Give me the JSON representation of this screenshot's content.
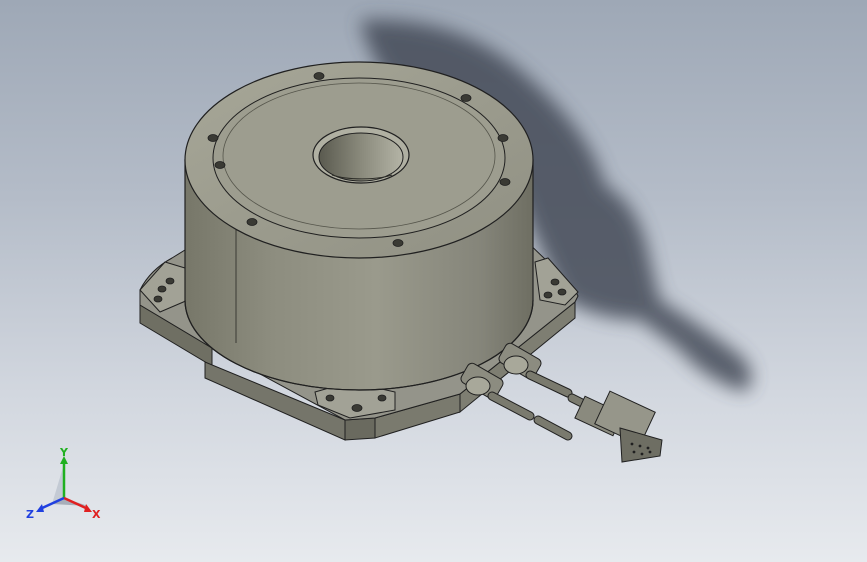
{
  "viewport": {
    "background_top": "#9ea8b6",
    "background_bottom": "#e7eaee"
  },
  "model": {
    "body_color": "#8e8e80",
    "edge_color": "#202020",
    "shadow_color": "#454c58"
  },
  "triad": {
    "x_label": "X",
    "y_label": "Y",
    "z_label": "Z",
    "x_color": "#e02020",
    "y_color": "#20b020",
    "z_color": "#2040e0"
  }
}
